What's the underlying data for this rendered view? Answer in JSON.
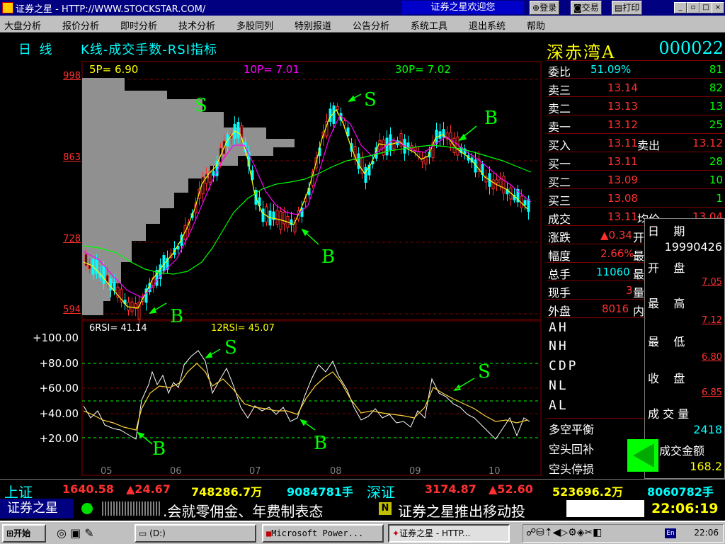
{
  "window": {
    "title": "证券之星 - HTTP://WWW.STOCKSTAR.COM/",
    "welcome": "证券之星欢迎您",
    "btn_login": "登录",
    "btn_trade": "交易",
    "btn_print": "打印"
  },
  "menu": [
    "大盘分析",
    "报价分析",
    "即时分析",
    "技术分析",
    "多股同列",
    "特别报道",
    "公告分析",
    "系统工具",
    "退出系统",
    "帮助"
  ],
  "chart": {
    "period": "日  线",
    "indicator": "K线-成交手数-RSI指标",
    "ma": [
      {
        "label": "5P=",
        "value": "6.90",
        "color": "#ffff00"
      },
      {
        "label": "10P=",
        "value": "7.01",
        "color": "#ff00ff"
      },
      {
        "label": "30P=",
        "value": "7.02",
        "color": "#00ff00"
      }
    ],
    "price_ticks": [
      "998",
      "863",
      "728",
      "594"
    ],
    "rsi_header": {
      "rsi6_label": "6RSI=",
      "rsi6": "41.14",
      "rsi12_label": "12RSI=",
      "rsi12": "45.07"
    },
    "rsi_ticks": [
      "+100.00",
      "+80.00",
      "+60.00",
      "+40.00",
      "+20.00"
    ],
    "months": [
      "05",
      "06",
      "07",
      "08",
      "09",
      "10"
    ],
    "annotations": {
      "s1": "S",
      "s2": "S",
      "b1": "B",
      "b2": "B",
      "b3": "B",
      "rsi_s1": "S",
      "rsi_s2": "S",
      "rsi_b1": "B",
      "rsi_b2": "B"
    }
  },
  "chart_data": {
    "type": "candlestick",
    "title": "K线-成交手数-RSI指标",
    "ylim": [
      594,
      998
    ],
    "x": [
      "05",
      "06",
      "07",
      "08",
      "09",
      "10"
    ],
    "series": [
      {
        "name": "5P",
        "value": 6.9
      },
      {
        "name": "10P",
        "value": 7.01
      },
      {
        "name": "30P",
        "value": 7.02
      },
      {
        "name": "6RSI",
        "value": 41.14
      },
      {
        "name": "12RSI",
        "value": 45.07
      }
    ]
  },
  "stock": {
    "name": "深赤湾A",
    "code": "000022"
  },
  "quote": [
    {
      "label": "委比",
      "v1": "51.09%",
      "v2": "81",
      "v1color": "#00ffff"
    },
    {
      "label": "卖三",
      "v1": "13.14",
      "v2": "82"
    },
    {
      "label": "卖二",
      "v1": "13.13",
      "v2": "13"
    },
    {
      "label": "卖一",
      "v1": "13.12",
      "v2": "25"
    },
    {
      "label": "买入",
      "v1": "13.11",
      "v1b_label": "卖出",
      "v2": "13.12"
    },
    {
      "label": "买一",
      "v1": "13.11",
      "v2": "28"
    },
    {
      "label": "买二",
      "v1": "13.09",
      "v2": "10"
    },
    {
      "label": "买三",
      "v1": "13.08",
      "v2": "1"
    },
    {
      "label": "成交",
      "v1": "13.11",
      "v1b_label": "均价",
      "v2": "13.04"
    },
    {
      "label": "涨跌",
      "v1": "▲0.34",
      "v1b_label": "开"
    },
    {
      "label": "幅度",
      "v1": "2.66%",
      "v1b_label": "最"
    },
    {
      "label": "总手",
      "v1": "11060",
      "v1b_label": "最",
      "v1color": "#00ffff"
    },
    {
      "label": "现手",
      "v1": "3",
      "v1b_label": "量"
    },
    {
      "label": "外盘",
      "v1": "8016",
      "v1b_label": "内"
    }
  ],
  "indicators": [
    "AH",
    "NH",
    "CDP",
    "NL",
    "AL"
  ],
  "bottom_list": [
    "多空平衡",
    "空头回补",
    "空头停损"
  ],
  "popup": {
    "date_label": "日    期",
    "date": "19990426",
    "open_label": "开    盘",
    "open": "7.05",
    "high_label": "最    高",
    "high": "7.12",
    "low_label": "最    低",
    "low": "6.80",
    "close_label": "收    盘",
    "close": "6.85",
    "vol_label": "成 交 量",
    "vol": "2418",
    "amt_label": "成交金额",
    "amt": "168.2"
  },
  "ticker": {
    "sh_label": "上证",
    "sh_index": "1640.58",
    "sh_change": "▲24.67",
    "sh_amount": "748286.7万",
    "sh_vol": "9084781手",
    "sz_label": "深证",
    "sz_index": "3174.87",
    "sz_change": "▲52.60",
    "sz_amount": "523696.2万",
    "sz_vol": "8060782手"
  },
  "status": {
    "brand": "证券之星",
    "marquee": ".会就零佣金、年费制表态",
    "marquee2": "证券之星推出移动投",
    "clock": "22:06:19"
  },
  "taskbar": {
    "start": "开始",
    "tasks": [
      "(D:)",
      "Microsoft Power...",
      "证券之星 - HTTP..."
    ],
    "time": "22:06"
  }
}
